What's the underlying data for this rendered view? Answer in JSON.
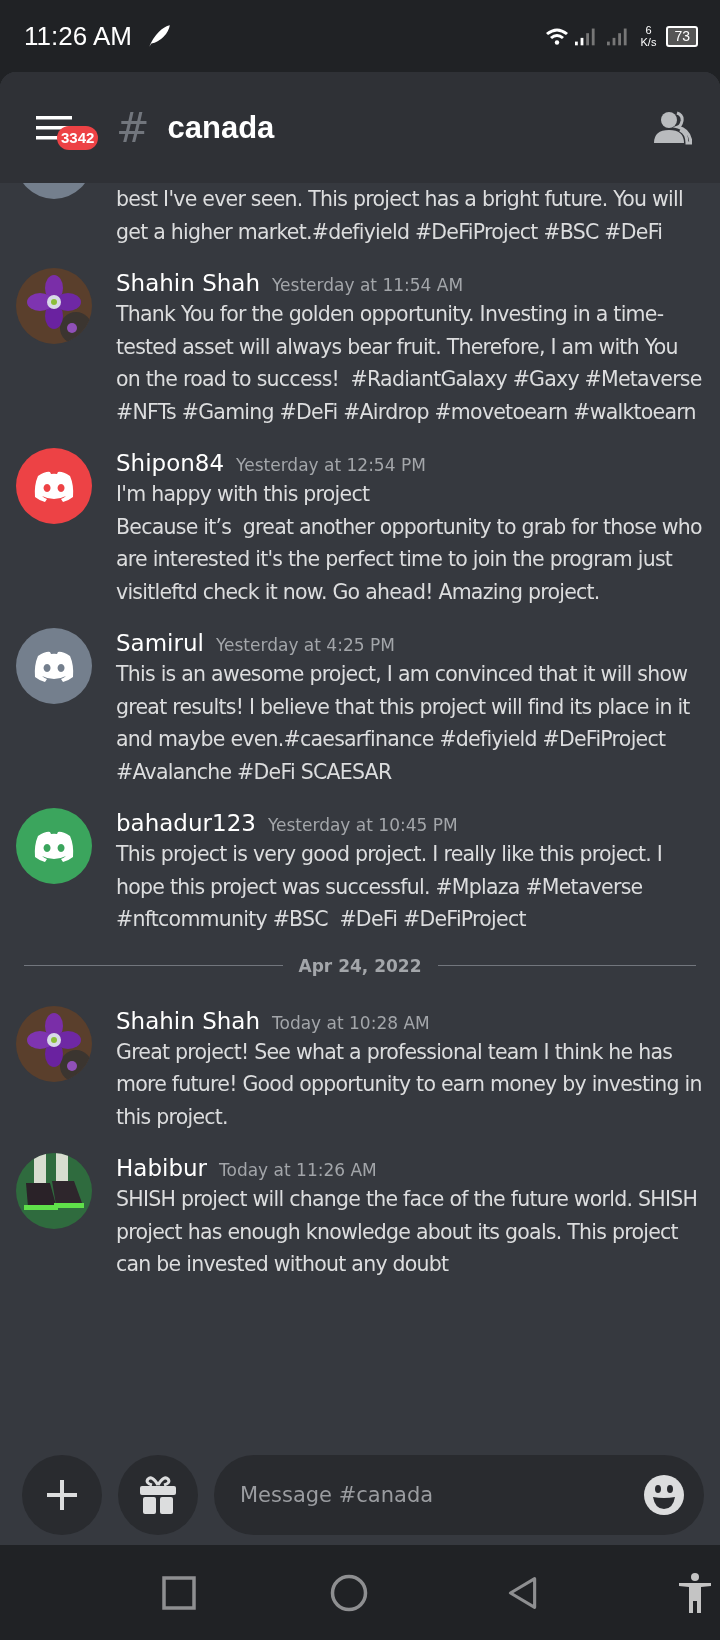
{
  "status_bar": {
    "time": "11:26 AM",
    "speed_value": "6",
    "speed_unit": "K/s",
    "battery": "73"
  },
  "header": {
    "badge": "3342",
    "channel_prefix": "#",
    "channel": "canada"
  },
  "messages": [
    {
      "kind": "partial",
      "avatar": {
        "kind": "default",
        "color": "#747f8d"
      },
      "text": "best I've ever seen. This project has a bright future. You will get a higher market.#defiyield #DeFiProject #BSC #DeFi"
    },
    {
      "kind": "full",
      "author": "Shahin Shah",
      "time": "Yesterday at 11:54 AM",
      "text": "Thank You for the golden opportunity. Investing in a time-tested asset will always bear fruit. Therefore, I am with You on the road to success!  #RadiantGalaxy #Gaxy #Metaverse #NFTs #Gaming #DeFi #Airdrop #movetoearn #walktoearn"
    },
    {
      "kind": "full",
      "author": "Shipon84",
      "time": "Yesterday at 12:54 PM",
      "avatar": {
        "kind": "default",
        "color": "#ed4245"
      },
      "text": "I'm happy with this project\nBecause it’s  great another opportunity to grab for those who are interested it's the perfect time to join the program just visitleftd check it now. Go ahead! Amazing project."
    },
    {
      "kind": "full",
      "author": "Samirul",
      "time": "Yesterday at 4:25 PM",
      "avatar": {
        "kind": "default",
        "color": "#747f8d"
      },
      "text": "This is an awesome project, I am convinced that it will show great results! I believe that this project will find its place in it and maybe even.#caesarfinance #defiyield #DeFiProject #Avalanche #DeFi SCAESAR"
    },
    {
      "kind": "full",
      "author": "bahadur123",
      "time": "Yesterday at 10:45 PM",
      "avatar": {
        "kind": "default",
        "color": "#3ba55d"
      },
      "text": "This project is very good project. I really like this project. I hope this project was successful. #Mplaza #Metaverse #nftcommunity #BSC  #DeFi #DeFiProject"
    },
    {
      "kind": "divider",
      "text": "Apr 24, 2022"
    },
    {
      "kind": "full",
      "author": "Shahin Shah",
      "time": "Today at 10:28 AM",
      "text": "Great project! See what a professional team I think he has more future! Good opportunity to earn money by investing in this project."
    },
    {
      "kind": "full",
      "author": "Habibur",
      "time": "Today at 11:26 AM",
      "text": "SHISH project will change the face of the future world. SHISH project has enough knowledge about its goals. This project can be invested without any doubt"
    }
  ],
  "composer": {
    "placeholder": "Message #canada"
  }
}
